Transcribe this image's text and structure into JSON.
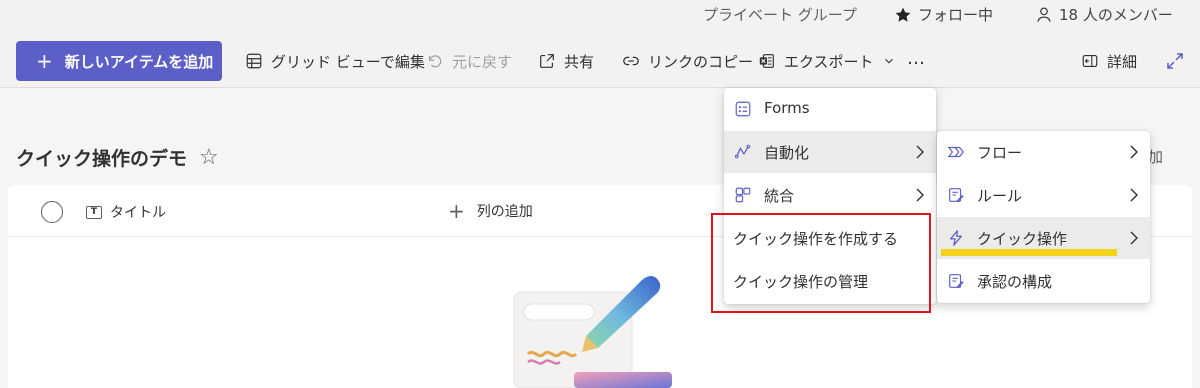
{
  "header": {
    "privacy": "プライベート グループ",
    "follow": "フォロー中",
    "members": "18 人のメンバー"
  },
  "toolbar": {
    "new_item": "新しいアイテムを追加",
    "grid_edit": "グリッド ビューで編集",
    "undo": "元に戻す",
    "share": "共有",
    "copy_link": "リンクのコピー",
    "export": "エクスポート",
    "more": "…",
    "details": "詳細"
  },
  "page": {
    "title": "クイック操作のデモ",
    "add_fragment": "加"
  },
  "table": {
    "columns": {
      "title": "タイトル",
      "add_column": "列の追加"
    }
  },
  "menu_main": {
    "items": [
      {
        "label": "Forms",
        "icon": "forms-icon"
      },
      {
        "label": "自動化",
        "icon": "automate-icon"
      },
      {
        "label": "統合",
        "icon": "integrate-icon"
      },
      {
        "label": "クイック操作を作成する"
      },
      {
        "label": "クイック操作の管理"
      }
    ]
  },
  "menu_sub": {
    "items": [
      {
        "label": "フロー",
        "icon": "flow-icon"
      },
      {
        "label": "ルール",
        "icon": "rule-icon"
      },
      {
        "label": "クイック操作",
        "icon": "bolt-icon"
      },
      {
        "label": "承認の構成",
        "icon": "approval-icon"
      }
    ]
  },
  "colors": {
    "brand": "#5b5fc7",
    "annotation_box": "#e0141e",
    "annotation_underline": "#f2d21a"
  }
}
